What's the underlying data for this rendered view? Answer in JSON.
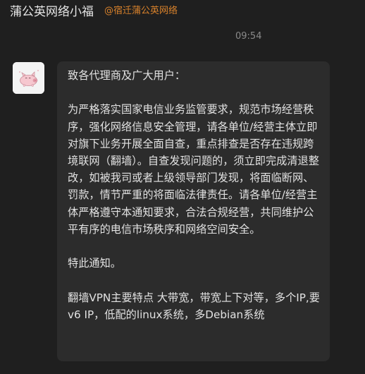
{
  "header": {
    "name": "蒲公英网络小福",
    "handle": "@宿迁蒲公英网络"
  },
  "timestamp": "09:54",
  "message": {
    "greeting": "致各代理商及广大用户：",
    "body": "为严格落实国家电信业务监管要求，规范市场经营秩序，强化网络信息安全管理，请各单位/经营主体立即对旗下业务开展全面自查，重点排查是否存在违规跨境联网（翻墙）。自查发现问题的，须立即完成清退整改，如被我司或者上级领导部门发现，将面临断网、罚款，情节严重的将面临法律责任。请各单位/经营主体严格遵守本通知要求，合法合规经营，共同维护公平有序的电信市场秩序和网络空间安全。",
    "notice": "特此通知。",
    "postscript": "翻墙VPN主要特点 大带宽，带宽上下对等，多个IP,要v6 IP，低配的linux系统，多Debian系统"
  },
  "colors": {
    "background": "#1f1f1f",
    "bubble": "#2c2c2c",
    "text": "#e2e2e2",
    "handle": "#d9822b",
    "timestamp": "#8a8a8a"
  },
  "icons": {
    "avatar": "pig-avatar-icon"
  }
}
